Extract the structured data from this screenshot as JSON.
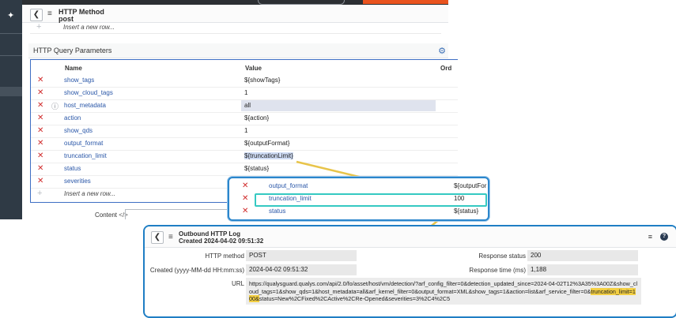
{
  "form": {
    "header_title": "HTTP Method",
    "header_subtitle": "post",
    "insert_row_label": "Insert a new row...",
    "section_title": "HTTP Query Parameters",
    "columns": {
      "name": "Name",
      "value": "Value",
      "order": "Ord"
    },
    "rows": [
      {
        "name": "show_tags",
        "value": "${showTags}"
      },
      {
        "name": "show_cloud_tags",
        "value": "1"
      },
      {
        "name": "host_metadata",
        "value": "all"
      },
      {
        "name": "action",
        "value": "${action}"
      },
      {
        "name": "show_qds",
        "value": "1"
      },
      {
        "name": "output_format",
        "value": "${outputFormat}"
      },
      {
        "name": "truncation_limit",
        "value": "${truncationLimit}"
      },
      {
        "name": "status",
        "value": "${status}"
      },
      {
        "name": "severities",
        "value": ""
      }
    ],
    "content_label": "Content",
    "content_icon": "</>"
  },
  "callout": {
    "rows": [
      {
        "name": "output_format",
        "value": "${outputFor"
      },
      {
        "name": "truncation_limit",
        "value": "100"
      },
      {
        "name": "status",
        "value": "${status}"
      }
    ]
  },
  "log": {
    "title": "Outbound HTTP Log",
    "subtitle": "Created 2024-04-02 09:51:32",
    "http_method_label": "HTTP method",
    "http_method_value": "POST",
    "created_label": "Created (yyyy-MM-dd HH:mm:ss)",
    "created_value": "2024-04-02 09:51:32",
    "response_status_label": "Response status",
    "response_status_value": "200",
    "response_time_label": "Response time (ms)",
    "response_time_value": "1,188",
    "url_label": "URL",
    "url_part1": "https://qualysguard.qualys.com/api/2.0/fo/asset/host/vm/detection/?arf_config_filter=0&detection_updated_since=2024-04-02T12%3A35%3A00Z&show_cloud_tags=1&show_qds=1&host_metadata=all&arf_kernel_filter=0&output_format=XML&show_tags=1&action=list&arf_service_filter=0&",
    "url_highlight": "truncation_limit=100&",
    "url_part2": "status=New%2CFixed%2CActive%2CRe-Opened&severities=3%2C4%2C5"
  },
  "colors": {
    "accent_blue": "#1f7ec4",
    "callout_teal": "#35c9c2",
    "arrow_yellow": "#e8c44a",
    "delete_red": "#d02a2a"
  }
}
